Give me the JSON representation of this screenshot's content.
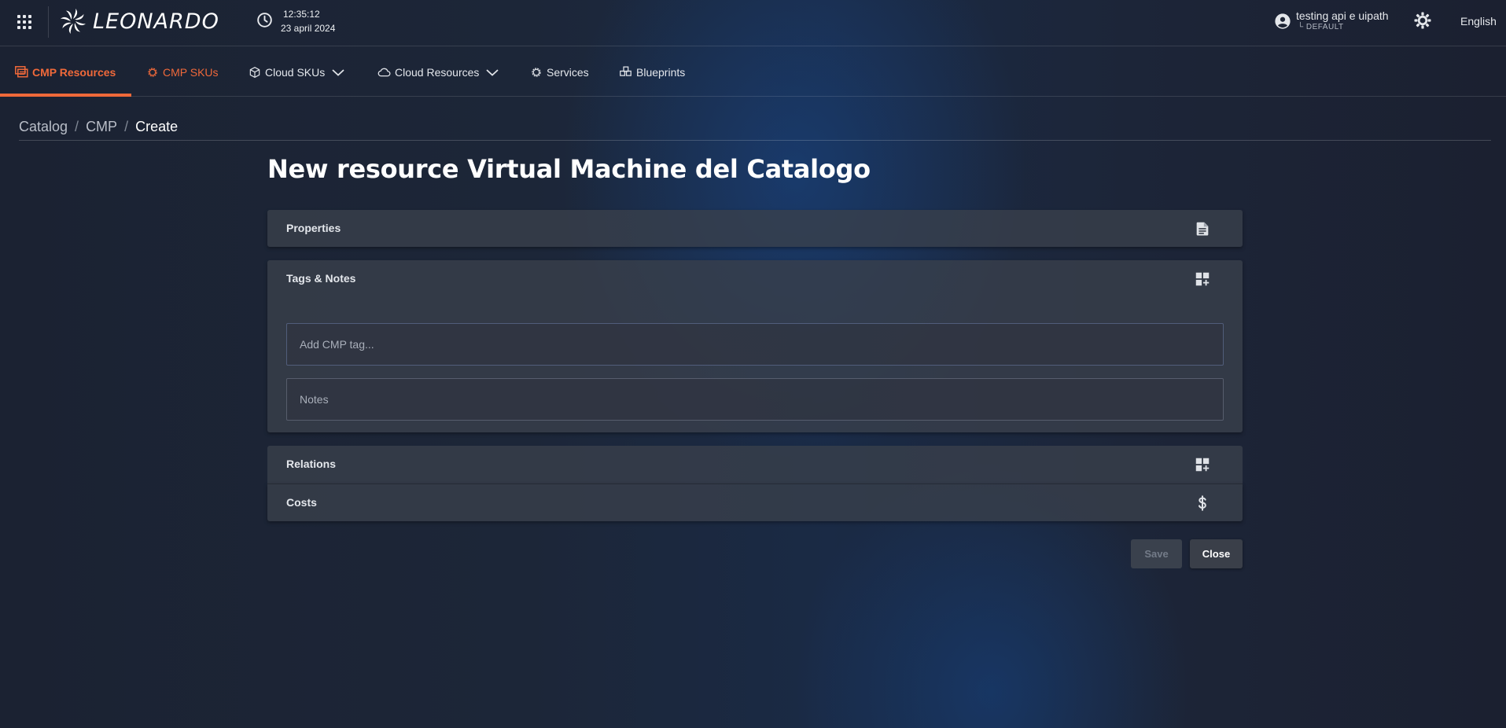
{
  "header": {
    "logo_text": "LEONARDO",
    "time": "12:35:12",
    "date": "23 april 2024",
    "user_name": "testing api e uipath",
    "user_tenant": "└ DEFAULT",
    "language": "English"
  },
  "nav": {
    "items": [
      {
        "label": "CMP Resources",
        "icon": "resources-icon",
        "active": true
      },
      {
        "label": "CMP SKUs",
        "icon": "gear-icon"
      },
      {
        "label": "Cloud SKUs",
        "icon": "box-icon",
        "dropdown": true
      },
      {
        "label": "Cloud Resources",
        "icon": "cloud-icon",
        "dropdown": true
      },
      {
        "label": "Services",
        "icon": "gear-icon"
      },
      {
        "label": "Blueprints",
        "icon": "blueprint-icon"
      }
    ]
  },
  "breadcrumb": {
    "items": [
      "Catalog",
      "CMP"
    ],
    "current": "Create",
    "separator": "/"
  },
  "page": {
    "title": "New resource Virtual Machine del Catalogo"
  },
  "panels": {
    "properties": {
      "title": "Properties",
      "icon": "document-icon"
    },
    "tags_notes": {
      "title": "Tags & Notes",
      "icon": "dashboard-add-icon",
      "tag_placeholder": "Add CMP tag...",
      "notes_placeholder": "Notes"
    },
    "relations": {
      "title": "Relations",
      "icon": "dashboard-add-icon"
    },
    "costs": {
      "title": "Costs",
      "icon": "dollar-icon"
    }
  },
  "actions": {
    "save_label": "Save",
    "close_label": "Close"
  },
  "colors": {
    "accent": "#f0693a",
    "background": "#1c2436",
    "panel": "#3a404c"
  }
}
